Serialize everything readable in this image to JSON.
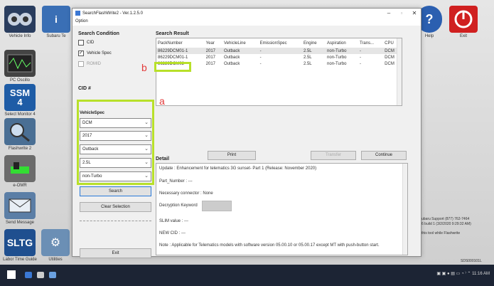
{
  "desktop": {
    "icons": [
      {
        "label": "Vehicle Info"
      },
      {
        "label": "Subaru Te"
      },
      {
        "label": "PC Oscillo"
      },
      {
        "label": "Select Monitor 4"
      },
      {
        "label": "Flashwrite 2"
      },
      {
        "label": "e-OMR"
      },
      {
        "label": "Send Message"
      },
      {
        "label": "Labor Time Guide"
      },
      {
        "label": "Utilities"
      },
      {
        "label": "Help"
      },
      {
        "label": "Exit"
      }
    ],
    "ssm_text": "SSM",
    "ssm_number": "4",
    "sltg_text": "SLTG",
    "support_line1": "ubaru Support  (877) 762-7464",
    "support_line2": "6 build 1 (3/2/2020 9:29:32 AM)",
    "help_line": "this tool while Flashwrite",
    "serial": "SDS000101L"
  },
  "window": {
    "title": "SearchFlashWrite2 - Ver.1.2.5.0",
    "menu": "Option",
    "search_condition": {
      "title": "Search Condition",
      "checkboxes": [
        {
          "label": "CID",
          "checked": false,
          "enabled": true
        },
        {
          "label": "Vehicle Spec",
          "checked": true,
          "enabled": true
        },
        {
          "label": "ROMID",
          "checked": false,
          "enabled": false
        }
      ],
      "cid_label": "CID #"
    },
    "vehicle_spec": {
      "title": "VehicleSpec",
      "selects": [
        "DCM",
        "2017",
        "Outback",
        "2.5L",
        "non-Turbo"
      ]
    },
    "buttons": {
      "search": "Search",
      "clear": "Clear Selection",
      "exit": "Exit",
      "print": "Print",
      "transfer": "Transfer",
      "continue": "Continue"
    },
    "results": {
      "title": "Search Result",
      "columns": [
        "PackNumber",
        "Year",
        "VehicleLine",
        "EmissionSpec",
        "Engine",
        "Aspiration",
        "Trans...",
        "CPU"
      ],
      "rows": [
        [
          "86229DCM01-1",
          "2017",
          "Outback",
          "-",
          "2.5L",
          "non-Turbo",
          "-",
          "DCM"
        ],
        [
          "86229DCM01-1",
          "2017",
          "Outback",
          "-",
          "2.5L",
          "non-Turbo",
          "-",
          "DCM"
        ],
        [
          "86229DCM02",
          "2017",
          "Outback",
          "-",
          "2.5L",
          "non-Turbo",
          "-",
          "DCM"
        ]
      ]
    },
    "detail": {
      "title": "Detail",
      "update": "Update : Enhancement for telematics 3G sunset- Part 1 (Release: November 2020)",
      "part_number": "Part_Number : ---",
      "connector": "Necessary connector : None",
      "decryption": "Decryption Keyword",
      "slim": "SLIM value : ---",
      "new_cid": "NEW CID : ---",
      "note": "Note : Applicable for Telematics models with software version 05.00.10 or 05.00.17 except MT with push-button start."
    }
  },
  "annotations": {
    "a": "a",
    "b": "b"
  },
  "colors": {
    "highlight": "#b8e02a",
    "annotation": "#e23a3a"
  },
  "taskbar": {
    "time": "11:16 AM"
  }
}
